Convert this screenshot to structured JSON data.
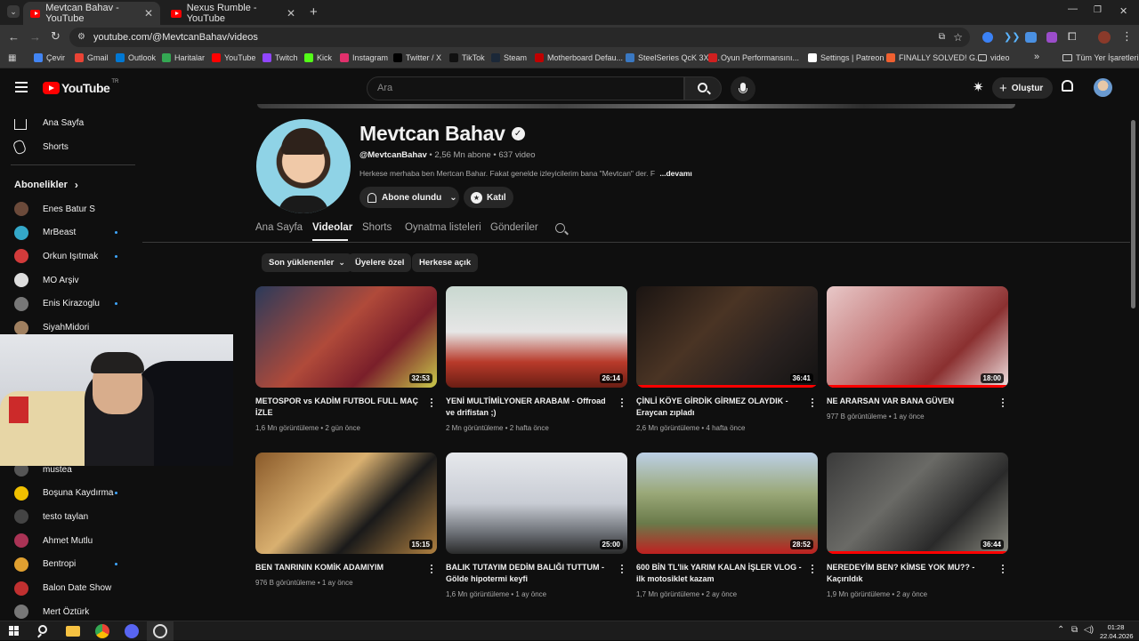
{
  "browser": {
    "tabs": [
      {
        "label": "Mevtcan Bahav - YouTube",
        "active": true
      },
      {
        "label": "Nexus Rumble - YouTube",
        "active": false
      }
    ],
    "new_tab": "+",
    "url": "youtube.com/@MevtcanBahav/videos",
    "bookmarks": [
      {
        "label": "Çevir",
        "color": "#4285f4"
      },
      {
        "label": "Gmail",
        "color": "#ea4335"
      },
      {
        "label": "Outlook",
        "color": "#0078d4"
      },
      {
        "label": "Haritalar",
        "color": "#34a853"
      },
      {
        "label": "YouTube",
        "color": "#ff0000"
      },
      {
        "label": "Twitch",
        "color": "#9146ff"
      },
      {
        "label": "Kick",
        "color": "#53fc18"
      },
      {
        "label": "Instagram",
        "color": "#e1306c"
      },
      {
        "label": "Twitter / X",
        "color": "#000000"
      },
      {
        "label": "TikTok",
        "color": "#111111"
      },
      {
        "label": "Steam",
        "color": "#1b2838"
      },
      {
        "label": "Motherboard Defau...",
        "color": "#c00000"
      },
      {
        "label": "SteelSeries QcK 3XL...",
        "color": "#3a78c2"
      },
      {
        "label": "Oyun Performansını...",
        "color": "#d02020"
      },
      {
        "label": "Settings | Patreon",
        "color": "#ffffff"
      },
      {
        "label": "FINALLY SOLVED! G...",
        "color": "#f06030"
      },
      {
        "label": "video",
        "color": "#f1f1f1"
      }
    ],
    "bookmarks_more": "»",
    "all_bookmarks": "Tüm Yer İşaretleri"
  },
  "youtube": {
    "logo": "YouTube",
    "logo_sup": "TR",
    "search_placeholder": "Ara",
    "create_label": "Oluştur"
  },
  "sidebar": {
    "home": "Ana Sayfa",
    "shorts": "Shorts",
    "subscriptions_title": "Abonelikler",
    "subs": [
      {
        "name": "Enes Batur S",
        "color": "#6b4a3a",
        "live_dot": false
      },
      {
        "name": "MrBeast",
        "color": "#34a8c9",
        "live_dot": true
      },
      {
        "name": "Orkun Işıtmak",
        "color": "#d23b3b",
        "live_dot": true
      },
      {
        "name": "MO Arşiv",
        "color": "#dddddd",
        "live_dot": false
      },
      {
        "name": "Enis Kirazoglu",
        "color": "#777777",
        "live_dot": true
      },
      {
        "name": "SiyahMidori",
        "color": "#a08060",
        "live_dot": false
      }
    ],
    "subs_lower": [
      {
        "name": "mustea",
        "color": "#555555",
        "live_dot": false
      },
      {
        "name": "Boşuna Kaydırma",
        "color": "#f0c000",
        "live_dot": true
      },
      {
        "name": "testo taylan",
        "color": "#444444",
        "live_dot": false
      },
      {
        "name": "Ahmet Mutlu",
        "color": "#aa3355",
        "live_dot": false
      },
      {
        "name": "Bentropi",
        "color": "#e0a030",
        "live_dot": true
      },
      {
        "name": "Balon Date Show",
        "color": "#c03030",
        "live_dot": false
      },
      {
        "name": "Mert Öztürk",
        "color": "#777777",
        "live_dot": false
      }
    ]
  },
  "channel": {
    "name": "Mevtcan Bahav",
    "handle": "@MevtcanBahav",
    "stats": " • 2,56 Mn abone • 637 video",
    "description": "Herkese merhaba ben Mertcan Bahar. Fakat genelde izleyicilerim bana \"Mevtcan\" der. F",
    "more": "...devamı",
    "subscribed_label": "Abone olundu",
    "join_label": "Katıl",
    "tabs": [
      "Ana Sayfa",
      "Videolar",
      "Shorts",
      "Oynatma listeleri",
      "Gönderiler"
    ],
    "active_tab": "Videolar",
    "chips": [
      "Son yüklenenler",
      "Üyelere özel",
      "Herkese açık"
    ]
  },
  "videos": [
    {
      "title": "METOSPOR vs KADİM FUTBOL FULL MAÇ İZLE",
      "views": "1,6 Mn görüntüleme",
      "age": "2 gün önce",
      "duration": "32:53",
      "bg": "linear-gradient(135deg,#2b3a5a 0%,#b04a3a 45%,#7a1f2a 70%,#c9c94a 100%)",
      "progress": 0
    },
    {
      "title": "YENİ MULTİMİLYONER ARABAM - Offroad ve drifistan ;)",
      "views": "2 Mn görüntüleme",
      "age": "2 hafta önce",
      "duration": "26:14",
      "bg": "linear-gradient(180deg,#c9d8d0 0%,#e6e6e6 45%,#b83a2a 75%,#6a1e14 100%)",
      "progress": 0
    },
    {
      "title": "ÇİNLİ KÖYE GİRDİK GİRMEZ OLAYDIK - Eraycan zıpladı",
      "views": "2,6 Mn görüntüleme",
      "age": "4 hafta önce",
      "duration": "36:41",
      "bg": "linear-gradient(135deg,#1a1412 0%,#4a3424 40%,#2a2220 70%,#121212 100%)",
      "progress": 1.0
    },
    {
      "title": "NE ARARSAN VAR BANA GÜVEN",
      "views": "977 B görüntüleme",
      "age": "1 ay önce",
      "duration": "18:00",
      "bg": "linear-gradient(135deg,#e8c8c8 0%,#c47a7a 40%,#8a3030 70%,#f0e0e0 100%)",
      "progress": 1.0
    },
    {
      "title": "BEN TANRININ KOMİK ADAMIYIM",
      "views": "976 B görüntüleme",
      "age": "1 ay önce",
      "duration": "15:15",
      "bg": "linear-gradient(135deg,#8a5a2a 0%,#d9b070 40%,#1a1a1a 65%,#b08040 100%)",
      "progress": 0
    },
    {
      "title": "BALIK TUTAYIM DEDİM BALIĞI TUTTUM - Gölde hipotermi keyfi",
      "views": "1,6 Mn görüntüleme",
      "age": "1 ay önce",
      "duration": "25:00",
      "bg": "linear-gradient(180deg,#e6e8ec 0%,#c8ccd4 50%,#6a6e74 80%,#2a2a2a 100%)",
      "progress": 0
    },
    {
      "title": "600 BİN TL'lik YARIM KALAN İŞLER VLOG - ilk motosiklet kazam",
      "views": "1,7 Mn görüntüleme",
      "age": "2 ay önce",
      "duration": "28:52",
      "bg": "linear-gradient(180deg,#bcd0e6 0%,#9aa878 40%,#6a7a4a 70%,#c02020 100%)",
      "progress": 0
    },
    {
      "title": "NEREDEYİM BEN? KİMSE YOK MU?? - Kaçırıldık",
      "views": "1,9 Mn görüntüleme",
      "age": "2 ay önce",
      "duration": "36:44",
      "bg": "linear-gradient(135deg,#3a3a3a 0%,#6a6a66 40%,#2a2a2a 70%,#8a8a80 100%)",
      "progress": 1.0
    }
  ],
  "taskbar": {
    "time": "01:28",
    "date": "22.04.2026"
  }
}
